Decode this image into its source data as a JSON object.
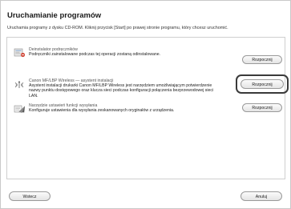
{
  "page": {
    "title": "Uruchamianie programów",
    "instruction": "Uruchamia programy z dysku CD-ROM. Kliknij przycisk [Start] po prawej stronie programu, który chcesz uruchomić."
  },
  "items": [
    {
      "title": "Deinstalator podręczników",
      "description": "Podręczniki zainstalowane podczas tej operacji zostaną odinstalowane.",
      "button": "Rozpocznij",
      "icon": "uninstall-icon"
    },
    {
      "title": "Canon MF/LBP Wireless — asystent instalacji",
      "description": "Asystent instalacji drukarki Canon MF/LBP Wireless jest narzędziem umożliwiającym potwierdzenie nazwy punktu dostępowego oraz klucza sieci podczas konfiguracji połączenia bezprzewodowej sieci LAN.",
      "button": "Rozpocznij",
      "icon": "wireless-icon"
    },
    {
      "title": "Narzędzie ustawień funkcji wysyłania",
      "description": "Konfiguruje ustawienia dla wysyłania zeskanowanych oryginałów z urządzenia.",
      "button": "Rozpocznij",
      "icon": "send-settings-icon"
    }
  ],
  "footer": {
    "back": "Wstecz",
    "cancel": "Anuluj"
  }
}
